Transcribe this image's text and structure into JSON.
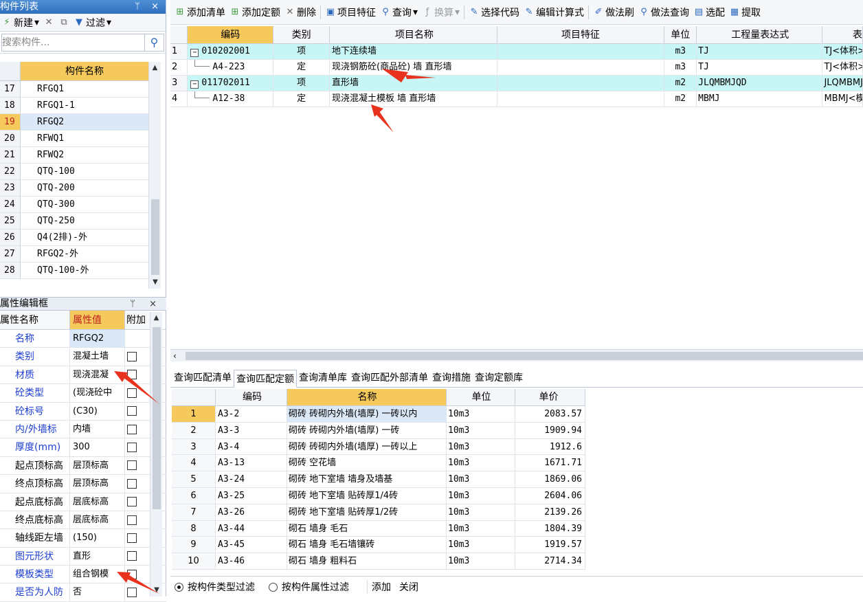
{
  "component_list": {
    "title": "构件列表",
    "title_icons": "ᛘ ×",
    "toolbar": {
      "new_label": "新建",
      "filter_label": "过滤"
    },
    "search_placeholder": "搜索构件...",
    "column_header": "构件名称",
    "rows": [
      {
        "num": "17",
        "name": "RFGQ1"
      },
      {
        "num": "18",
        "name": "RFGQ1-1"
      },
      {
        "num": "19",
        "name": "RFGQ2"
      },
      {
        "num": "20",
        "name": "RFWQ1"
      },
      {
        "num": "21",
        "name": "RFWQ2"
      },
      {
        "num": "22",
        "name": "QTQ-100"
      },
      {
        "num": "23",
        "name": "QTQ-200"
      },
      {
        "num": "24",
        "name": "QTQ-300"
      },
      {
        "num": "25",
        "name": "QTQ-250"
      },
      {
        "num": "26",
        "name": "Q4(2排)-外"
      },
      {
        "num": "27",
        "name": "RFGQ2-外"
      },
      {
        "num": "28",
        "name": "QTQ-100-外"
      }
    ],
    "selected_index": 2
  },
  "property_editor": {
    "title": "属性编辑框",
    "title_icons": "ᛘ ×",
    "headers": {
      "name": "属性名称",
      "value": "属性值",
      "extra": "附加"
    },
    "rows": [
      {
        "name": "名称",
        "value": "RFGQ2",
        "blue": true,
        "check": false
      },
      {
        "name": "类别",
        "value": "混凝土墙",
        "blue": true,
        "check": true
      },
      {
        "name": "材质",
        "value": "现浇混凝",
        "blue": true,
        "check": true
      },
      {
        "name": "砼类型",
        "value": "(现浇砼中",
        "blue": true,
        "check": true
      },
      {
        "name": "砼标号",
        "value": "(C30)",
        "blue": true,
        "check": true
      },
      {
        "name": "内/外墙标",
        "value": "内墙",
        "blue": true,
        "check": true
      },
      {
        "name": "厚度(mm)",
        "value": "300",
        "blue": true,
        "check": true
      },
      {
        "name": "起点顶标高",
        "value": "层顶标高",
        "blue": false,
        "check": true
      },
      {
        "name": "终点顶标高",
        "value": "层顶标高",
        "blue": false,
        "check": true
      },
      {
        "name": "起点底标高",
        "value": "层底标高",
        "blue": false,
        "check": true
      },
      {
        "name": "终点底标高",
        "value": "层底标高",
        "blue": false,
        "check": true
      },
      {
        "name": "轴线距左墙",
        "value": "(150)",
        "blue": false,
        "check": true
      },
      {
        "name": "图元形状",
        "value": "直形",
        "blue": true,
        "check": true
      },
      {
        "name": "模板类型",
        "value": "组合钢模",
        "blue": true,
        "check": true
      },
      {
        "name": "是否为人防",
        "value": "否",
        "blue": true,
        "check": true
      }
    ]
  },
  "main_toolbar": {
    "add_list": "添加清单",
    "add_quota": "添加定额",
    "delete": "删除",
    "item_features": "项目特征",
    "query": "查询",
    "convert": "换算",
    "select_code": "选择代码",
    "edit_formula": "编辑计算式",
    "method_brush": "做法刷",
    "method_query": "做法查询",
    "select_match": "选配",
    "extract": "提取"
  },
  "upper_grid": {
    "headers": [
      "编码",
      "类别",
      "项目名称",
      "项目特征",
      "单位",
      "工程量表达式",
      "表"
    ],
    "rows": [
      {
        "num": "1",
        "code": "010202001",
        "type": "项",
        "name": "地下连续墙",
        "feature": "",
        "unit": "m3",
        "expr": "TJ",
        "expr2": "TJ<体积>",
        "level": "list"
      },
      {
        "num": "2",
        "code": "A4-223",
        "type": "定",
        "name": "现浇钢筋砼(商品砼) 墙 直形墙",
        "feature": "",
        "unit": "m3",
        "expr": "TJ",
        "expr2": "TJ<体积>",
        "level": "quota"
      },
      {
        "num": "3",
        "code": "011702011",
        "type": "项",
        "name": "直形墙",
        "feature": "",
        "unit": "m2",
        "expr": "JLQMBMJQD",
        "expr2": "JLQMBMJQ",
        "level": "list"
      },
      {
        "num": "4",
        "code": "A12-38",
        "type": "定",
        "name": "现浇混凝土模板 墙 直形墙",
        "feature": "",
        "unit": "m2",
        "expr": "MBMJ",
        "expr2": "MBMJ<模板",
        "level": "quota"
      }
    ]
  },
  "lower_tabs": [
    "查询匹配清单",
    "查询匹配定额",
    "查询清单库",
    "查询匹配外部清单",
    "查询措施",
    "查询定额库"
  ],
  "lower_active_tab": 1,
  "lower_grid": {
    "headers": [
      "编码",
      "名称",
      "单位",
      "单价"
    ],
    "rows": [
      {
        "num": "1",
        "code": "A3-2",
        "name": "砌砖 砖砌内外墙(墙厚) 一砖以内",
        "unit": "10m3",
        "price": "2083.57"
      },
      {
        "num": "2",
        "code": "A3-3",
        "name": "砌砖 砖砌内外墙(墙厚) 一砖",
        "unit": "10m3",
        "price": "1909.94"
      },
      {
        "num": "3",
        "code": "A3-4",
        "name": "砌砖 砖砌内外墙(墙厚) 一砖以上",
        "unit": "10m3",
        "price": "1912.6"
      },
      {
        "num": "4",
        "code": "A3-13",
        "name": "砌砖 空花墙",
        "unit": "10m3",
        "price": "1671.71"
      },
      {
        "num": "5",
        "code": "A3-24",
        "name": "砌砖 地下室墙 墙身及墙基",
        "unit": "10m3",
        "price": "1869.06"
      },
      {
        "num": "6",
        "code": "A3-25",
        "name": "砌砖 地下室墙 贴砖厚1/4砖",
        "unit": "10m3",
        "price": "2604.06"
      },
      {
        "num": "7",
        "code": "A3-26",
        "name": "砌砖 地下室墙 贴砖厚1/2砖",
        "unit": "10m3",
        "price": "2139.26"
      },
      {
        "num": "8",
        "code": "A3-44",
        "name": "砌石 墙身 毛石",
        "unit": "10m3",
        "price": "1804.39"
      },
      {
        "num": "9",
        "code": "A3-45",
        "name": "砌石 墙身 毛石墙镶砖",
        "unit": "10m3",
        "price": "1919.57"
      },
      {
        "num": "10",
        "code": "A3-46",
        "name": "砌石 墙身 粗料石",
        "unit": "10m3",
        "price": "2714.34"
      }
    ]
  },
  "filter_bar": {
    "by_type": "按构件类型过滤",
    "by_attr": "按构件属性过滤",
    "add": "添加",
    "close": "关闭"
  },
  "colors": {
    "accent": "#f5c95b",
    "list_row": "#c8f5f5",
    "arrow": "#e8321e",
    "title_blue": "#2f6fc0"
  }
}
